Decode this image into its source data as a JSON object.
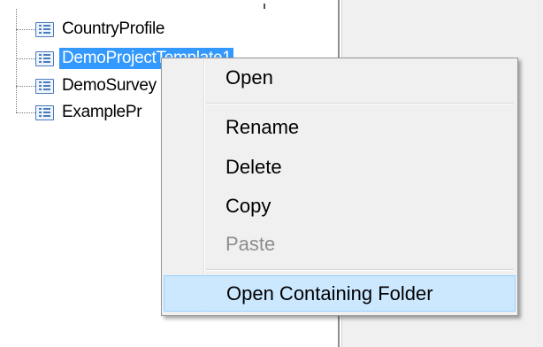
{
  "tree": {
    "items": [
      {
        "label": "CountryProfile",
        "selected": false
      },
      {
        "label": "DemoProjectTemplate1",
        "selected": true
      },
      {
        "label": "DemoSurvey",
        "selected": false
      },
      {
        "label": "ExamplePr",
        "selected": false
      }
    ]
  },
  "context_menu": {
    "items": [
      {
        "label": "Open"
      },
      {
        "label": "Rename"
      },
      {
        "label": "Delete"
      },
      {
        "label": "Copy"
      },
      {
        "label": "Paste",
        "disabled": true
      },
      {
        "label": "Open Containing Folder",
        "highlighted": true
      }
    ]
  },
  "colors": {
    "selection": "#3399ff",
    "menu_background": "#f0f0f0",
    "menu_highlight": "#cce8ff",
    "disabled_text": "#8d8d8d",
    "tree_icon": "#4a7bbd"
  }
}
